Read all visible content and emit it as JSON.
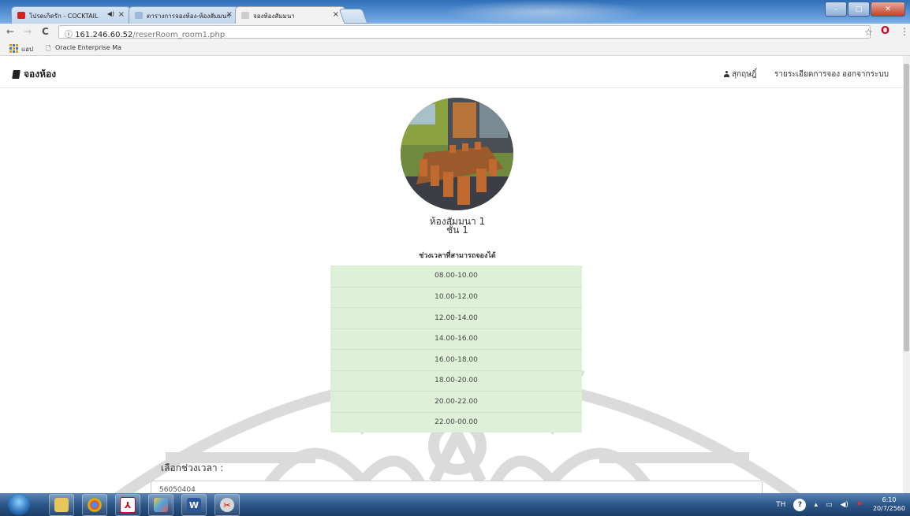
{
  "browser": {
    "tabs": [
      {
        "title": "โปรดเกิดรัก - COCKTAIL",
        "favicon_color": "#d32020",
        "active": false
      },
      {
        "title": "ตารางการจองห้อง-ห้องสัมมนา",
        "favicon_color": "#9bb8d8",
        "active": false
      },
      {
        "title": "จองห้องสัมมนา",
        "favicon_color": "#cccccc",
        "active": true
      }
    ],
    "url_host": "161.246.60.52",
    "url_path": "/reserRoom_room1.php",
    "bookmarks": {
      "apps_label": "แอป",
      "items": [
        "Oracle Enterprise Ma"
      ]
    }
  },
  "navbar": {
    "brand": "จองห้อง",
    "user": "สุกฤษฎิ์",
    "details": "รายระเอียดการจอง",
    "logout": "ออกจากระบบ"
  },
  "room": {
    "name": "ห้องสัมมนา 1",
    "floor": "ชั้น 1"
  },
  "slots": {
    "title": "ช่วงเวลาที่สามารถจองได้",
    "items": [
      "08.00-10.00",
      "10.00-12.00",
      "12.00-14.00",
      "14.00-16.00",
      "16.00-18.00",
      "18.00-20.00",
      "20.00-22.00",
      "22.00-00.00"
    ],
    "background": "#dff0d8"
  },
  "form": {
    "select_label": "เลือกช่วงเวลา :",
    "select_value": "56050404"
  },
  "taskbar": {
    "lang": "TH",
    "time": "6:10",
    "date": "20/7/2560"
  }
}
